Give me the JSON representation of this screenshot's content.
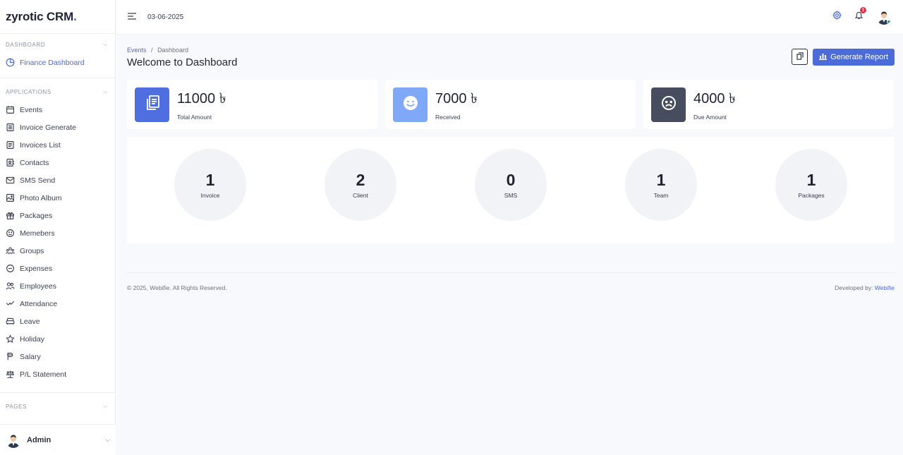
{
  "brand": {
    "name": "zyrotic CRM",
    "dot": "."
  },
  "topbar": {
    "date": "03-06-2025",
    "notifications": "1"
  },
  "sidebar": {
    "sections": {
      "dashboard": "DASHBOARD",
      "applications": "APPLICATIONS",
      "pages": "PAGES"
    },
    "dashboard_items": [
      {
        "label": "Finance Dashboard",
        "icon": "pie-chart-icon"
      }
    ],
    "items": [
      {
        "label": "Events",
        "icon": "calendar-icon"
      },
      {
        "label": "Invoice Generate",
        "icon": "document-icon"
      },
      {
        "label": "Invoices List",
        "icon": "document-list-icon"
      },
      {
        "label": "Contacts",
        "icon": "contact-book-icon"
      },
      {
        "label": "SMS Send",
        "icon": "mail-icon"
      },
      {
        "label": "Photo Album",
        "icon": "image-icon"
      },
      {
        "label": "Packages",
        "icon": "gift-icon"
      },
      {
        "label": "Memebers",
        "icon": "smile-icon"
      },
      {
        "label": "Groups",
        "icon": "group-icon"
      },
      {
        "label": "Expenses",
        "icon": "minus-circle-icon"
      },
      {
        "label": "Employees",
        "icon": "users-icon"
      },
      {
        "label": "Attendance",
        "icon": "check-wave-icon"
      },
      {
        "label": "Leave",
        "icon": "sofa-icon"
      },
      {
        "label": "Holiday",
        "icon": "star-icon"
      },
      {
        "label": "Salary",
        "icon": "money-icon"
      },
      {
        "label": "P/L Statement",
        "icon": "scale-icon"
      }
    ],
    "user": {
      "name": "Admin"
    }
  },
  "main": {
    "breadcrumb": {
      "parent": "Events",
      "separator": "/",
      "current": "Dashboard"
    },
    "title": "Welcome to Dashboard",
    "generate_report": "Generate Report",
    "stats": [
      {
        "value": "11000 ৳",
        "label": "Total Amount",
        "color": "#4f6fe0",
        "icon": "documents-icon"
      },
      {
        "value": "7000 ৳",
        "label": "Received",
        "color": "#7fa8f7",
        "icon": "smile-icon"
      },
      {
        "value": "4000 ৳",
        "label": "Due Amount",
        "color": "#474d5f",
        "icon": "sad-face-icon"
      }
    ],
    "counters": [
      {
        "value": "1",
        "label": "Invoice"
      },
      {
        "value": "2",
        "label": "Client"
      },
      {
        "value": "0",
        "label": "SMS"
      },
      {
        "value": "1",
        "label": "Team"
      },
      {
        "value": "1",
        "label": "Packages"
      }
    ]
  },
  "footer": {
    "copyright": "© 2025, Webifie. All Rights Reserved.",
    "developed_prefix": "Developed by: ",
    "developer": "Webifie"
  }
}
